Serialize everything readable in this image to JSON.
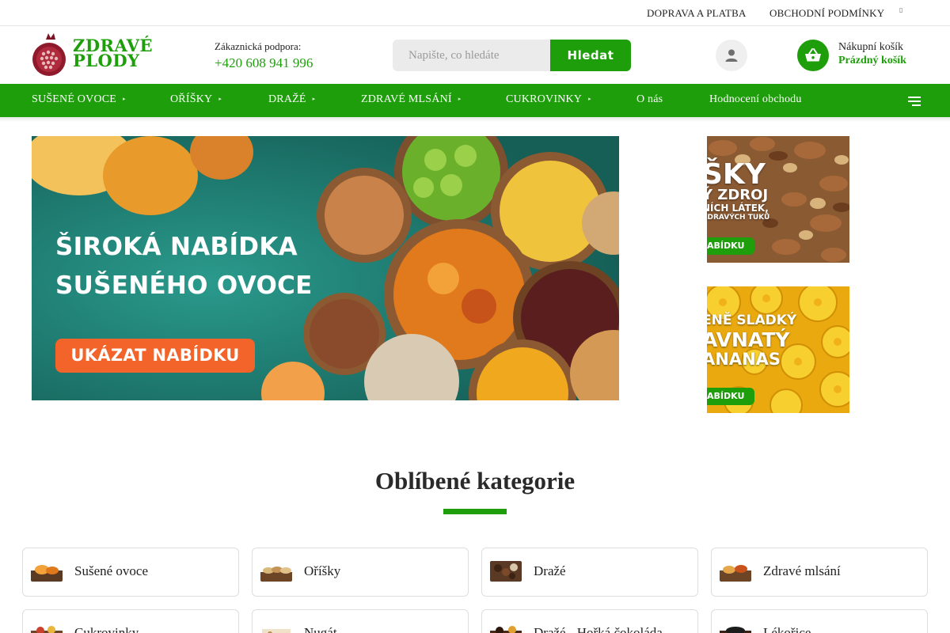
{
  "topbar": {
    "links": [
      "DOPRAVA A PLATBA",
      "OBCHODNÍ PODMÍNKY"
    ],
    "extra_glyph": "▯"
  },
  "brand": {
    "name_line1": "ZDRAVÉ",
    "name_line2": "PLODY",
    "color": "#1e9e0b"
  },
  "support": {
    "label": "Zákaznická podpora:",
    "phone": "+420 608 941 996"
  },
  "search": {
    "placeholder": "Napište, co hledáte",
    "value": "",
    "button_label": "Hledat"
  },
  "cart": {
    "title": "Nákupní košík",
    "status": "Prázdný košík"
  },
  "icons": {
    "user": "user-icon",
    "cart": "basket-icon",
    "menu": "hamburger-icon"
  },
  "nav": {
    "items": [
      {
        "label": "SUŠENÉ OVOCE",
        "has_dropdown": true
      },
      {
        "label": "OŘÍŠKY",
        "has_dropdown": true
      },
      {
        "label": "DRAŽÉ",
        "has_dropdown": true
      },
      {
        "label": "ZDRAVÉ MLSÁNÍ",
        "has_dropdown": true
      },
      {
        "label": "CUKROVINKY",
        "has_dropdown": true
      },
      {
        "label": "O nás",
        "has_dropdown": false
      },
      {
        "label": "Hodnocení obchodu",
        "has_dropdown": false
      }
    ],
    "caret": "▸"
  },
  "hero": {
    "line1": "ŠIROKÁ NABÍDKA",
    "line2": "SUŠENÉHO OVOCE",
    "cta": "UKÁZAT NABÍDKU"
  },
  "promos": [
    {
      "lines": [
        "ŠKY",
        "Ý ZDROJ",
        "NÍCH LÁTEK,",
        "ZDRAVÝCH TUKŮ"
      ],
      "button": "ABÍDKU"
    },
    {
      "lines": [
        "ENĚ SLADKÝ",
        "AVNATÝ",
        "ANANAS"
      ],
      "button": "ABÍDKU"
    }
  ],
  "categories": {
    "title": "Oblíbené kategorie",
    "items": [
      {
        "label": "Sušené ovoce"
      },
      {
        "label": "Oříšky"
      },
      {
        "label": "Dražé"
      },
      {
        "label": "Zdravé mlsání"
      },
      {
        "label": "Cukrovinky"
      },
      {
        "label": "Nugát"
      },
      {
        "label": "Dražé - Hořká čokoláda"
      },
      {
        "label": "Lékořice"
      }
    ]
  }
}
